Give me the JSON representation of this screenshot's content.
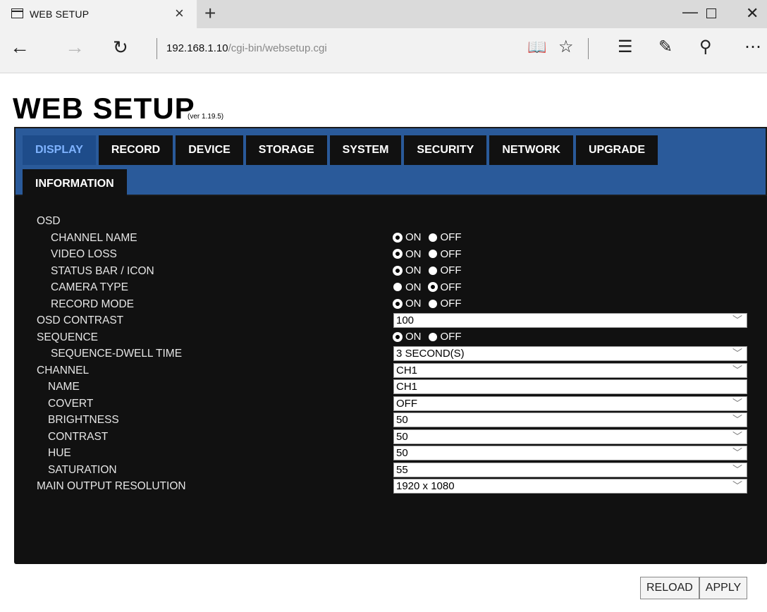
{
  "browser": {
    "tab_title": "WEB SETUP",
    "tab_close": "×",
    "new_tab": "+",
    "window_min": "—",
    "window_close": "✕",
    "nav_back": "←",
    "nav_forward": "→",
    "nav_refresh": "↻",
    "address_host": "192.168.1.10",
    "address_path": "/cgi-bin/websetup.cgi",
    "icons": {
      "reading": "📖",
      "star": "☆",
      "hub": "☰",
      "note": "✎",
      "share": "⚲",
      "more": "⋯"
    }
  },
  "page": {
    "title": "WEB SETUP",
    "version": "(ver 1.19.5)"
  },
  "tabs": {
    "row1": [
      "DISPLAY",
      "RECORD",
      "DEVICE",
      "STORAGE",
      "SYSTEM",
      "SECURITY",
      "NETWORK",
      "UPGRADE"
    ],
    "row2": [
      "INFORMATION"
    ],
    "active": "DISPLAY"
  },
  "form": {
    "osd": "OSD",
    "channel_name": {
      "label": "CHANNEL NAME",
      "on": "ON",
      "off": "OFF",
      "value": "ON"
    },
    "video_loss": {
      "label": "VIDEO LOSS",
      "on": "ON",
      "off": "OFF",
      "value": "ON"
    },
    "status_bar": {
      "label": "STATUS BAR / ICON",
      "on": "ON",
      "off": "OFF",
      "value": "ON"
    },
    "camera_type": {
      "label": "CAMERA TYPE",
      "on": "ON",
      "off": "OFF",
      "value": "OFF"
    },
    "record_mode": {
      "label": "RECORD MODE",
      "on": "ON",
      "off": "OFF",
      "value": "ON"
    },
    "osd_contrast": {
      "label": "OSD CONTRAST",
      "value": "100"
    },
    "sequence": {
      "label": "SEQUENCE",
      "on": "ON",
      "off": "OFF",
      "value": "ON"
    },
    "dwell_time": {
      "label": "SEQUENCE-DWELL TIME",
      "value": "3 SECOND(S)"
    },
    "channel": {
      "label": "CHANNEL",
      "value": "CH1"
    },
    "name": {
      "label": "NAME",
      "value": "CH1"
    },
    "covert": {
      "label": "COVERT",
      "value": "OFF"
    },
    "brightness": {
      "label": "BRIGHTNESS",
      "value": "50"
    },
    "contrast": {
      "label": "CONTRAST",
      "value": "50"
    },
    "hue": {
      "label": "HUE",
      "value": "50"
    },
    "saturation": {
      "label": "SATURATION",
      "value": "55"
    },
    "resolution": {
      "label": "MAIN OUTPUT RESOLUTION",
      "value": "1920 x 1080"
    }
  },
  "buttons": {
    "reload": "RELOAD",
    "apply": "APPLY"
  },
  "colors": {
    "panel_bg": "#111111",
    "tabs_bg": "#2a5a9a",
    "active_tab_text": "#7fb3ff"
  }
}
